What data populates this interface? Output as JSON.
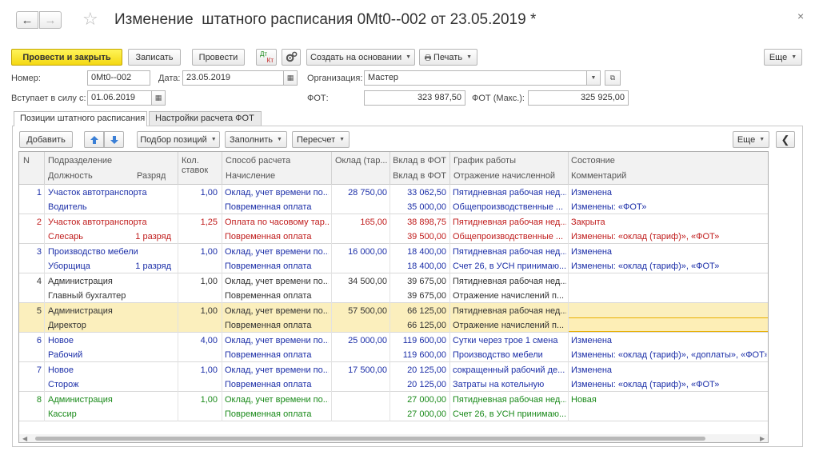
{
  "window": {
    "title": "Изменение  штатного расписания 0Mt0--002 от 23.05.2019 *",
    "back_icon": "←",
    "forward_icon": "→",
    "star_icon": "☆",
    "close_icon": "×"
  },
  "toolbar": {
    "post_close": "Провести и закрыть",
    "save": "Записать",
    "post": "Провести",
    "dtkt_dt": "Дт",
    "dtkt_kt": "Кт",
    "create_based": "Создать на основании",
    "print": "Печать",
    "more": "Еще"
  },
  "header": {
    "number_label": "Номер:",
    "number_value": "0Mt0--002",
    "date_label": "Дата:",
    "date_value": "23.05.2019",
    "org_label": "Организация:",
    "org_value": "Мастер",
    "effective_label": "Вступает в силу с:",
    "effective_value": "01.06.2019",
    "fot_label": "ФОТ:",
    "fot_value": "323 987,50",
    "fot_max_label": "ФОТ (Макс.):",
    "fot_max_value": "325 925,00"
  },
  "tabs": [
    {
      "label": "Позиции штатного расписания"
    },
    {
      "label": "Настройки расчета ФОТ"
    }
  ],
  "grid_toolbar": {
    "add": "Добавить",
    "selection": "Подбор позиций",
    "fill": "Заполнить",
    "recalc": "Пересчет",
    "more": "Еще"
  },
  "columns": {
    "n": "N",
    "department": "Подразделение",
    "position": "Должность",
    "grade": "Разряд",
    "rates_1": "Кол.",
    "rates_2": "ставок",
    "calc_method": "Способ расчета",
    "accrual": "Начисление",
    "salary": "Оклад (тар...",
    "fot_share": "Вклад в ФОТ",
    "fot_share_2": "Вклад в ФОТ",
    "schedule": "График работы",
    "accounting": "Отражение начисленной",
    "state": "Состояние",
    "comment": "Комментарий"
  },
  "rows": [
    {
      "n": "1",
      "dept": "Участок автотранспорта",
      "pos": "Водитель",
      "grade": "",
      "rates": "1,00",
      "method": "Оклад, учет времени по...",
      "accrual": "Повременная оплата",
      "salary": "28 750,00",
      "fot1": "33 062,50",
      "fot2": "35 000,00",
      "schedule": "Пятидневная рабочая нед...",
      "acc": "Общепроизводственные ...",
      "state": "Изменена",
      "comment": "Изменены: «ФОТ»",
      "color": "blue"
    },
    {
      "n": "2",
      "dept": "Участок автотранспорта",
      "pos": "Слесарь",
      "grade": "1 разряд",
      "rates": "1,25",
      "method": "Оплата по часовому тар...",
      "accrual": "Повременная оплата",
      "salary": "165,00",
      "fot1": "38 898,75",
      "fot2": "39 500,00",
      "schedule": "Пятидневная рабочая нед...",
      "acc": "Общепроизводственные ...",
      "state": "Закрыта",
      "comment": "Изменены: «оклад (тариф)», «ФОТ»",
      "color": "red"
    },
    {
      "n": "3",
      "dept": "Производство мебели",
      "pos": "Уборщица",
      "grade": "1 разряд",
      "rates": "1,00",
      "method": "Оклад, учет времени по...",
      "accrual": "Повременная оплата",
      "salary": "16 000,00",
      "fot1": "18 400,00",
      "fot2": "18 400,00",
      "schedule": "Пятидневная рабочая нед...",
      "acc": "Счет 26, в УСН принимаю...",
      "state": "Изменена",
      "comment": "Изменены: «оклад (тариф)», «ФОТ»",
      "color": "blue"
    },
    {
      "n": "4",
      "dept": "Администрация",
      "pos": "Главный бухгалтер",
      "grade": "",
      "rates": "1,00",
      "method": "Оклад, учет времени по...",
      "accrual": "Повременная оплата",
      "salary": "34 500,00",
      "fot1": "39 675,00",
      "fot2": "39 675,00",
      "schedule": "Пятидневная рабочая нед...",
      "acc": "Отражение начислений п...",
      "state": "",
      "comment": "",
      "color": "dark"
    },
    {
      "n": "5",
      "dept": "Администрация",
      "pos": "Директор",
      "grade": "",
      "rates": "1,00",
      "method": "Оклад, учет времени по...",
      "accrual": "Повременная оплата",
      "salary": "57 500,00",
      "fot1": "66 125,00",
      "fot2": "66 125,00",
      "schedule": "Пятидневная рабочая нед...",
      "acc": "Отражение начислений п...",
      "state": "",
      "comment": "",
      "color": "dark",
      "selected": true
    },
    {
      "n": "6",
      "dept": "Новое",
      "pos": "Рабочий",
      "grade": "",
      "rates": "4,00",
      "method": "Оклад, учет времени по...",
      "accrual": "Повременная оплата",
      "salary": "25 000,00",
      "fot1": "119 600,00",
      "fot2": "119 600,00",
      "schedule": "Сутки через трое 1 смена",
      "acc": "Производство мебели",
      "state": "Изменена",
      "comment": "Изменены: «оклад (тариф)», «доплаты», «ФОТ»",
      "color": "blue"
    },
    {
      "n": "7",
      "dept": "Новое",
      "pos": "Сторож",
      "grade": "",
      "rates": "1,00",
      "method": "Оклад, учет времени по...",
      "accrual": "Повременная оплата",
      "salary": "17 500,00",
      "fot1": "20 125,00",
      "fot2": "20 125,00",
      "schedule": "сокращенный рабочий де...",
      "acc": "Затраты на котельную",
      "state": "Изменена",
      "comment": "Изменены: «оклад (тариф)», «ФОТ»",
      "color": "blue"
    },
    {
      "n": "8",
      "dept": "Администрация",
      "pos": "Кассир",
      "grade": "",
      "rates": "1,00",
      "method": "Оклад, учет времени по...",
      "accrual": "Повременная оплата",
      "salary": "",
      "fot1": "27 000,00",
      "fot2": "27 000,00",
      "schedule": "Пятидневная рабочая нед...",
      "acc": "Счет 26, в УСН принимаю...",
      "state": "Новая",
      "comment": "",
      "color": "green"
    }
  ]
}
